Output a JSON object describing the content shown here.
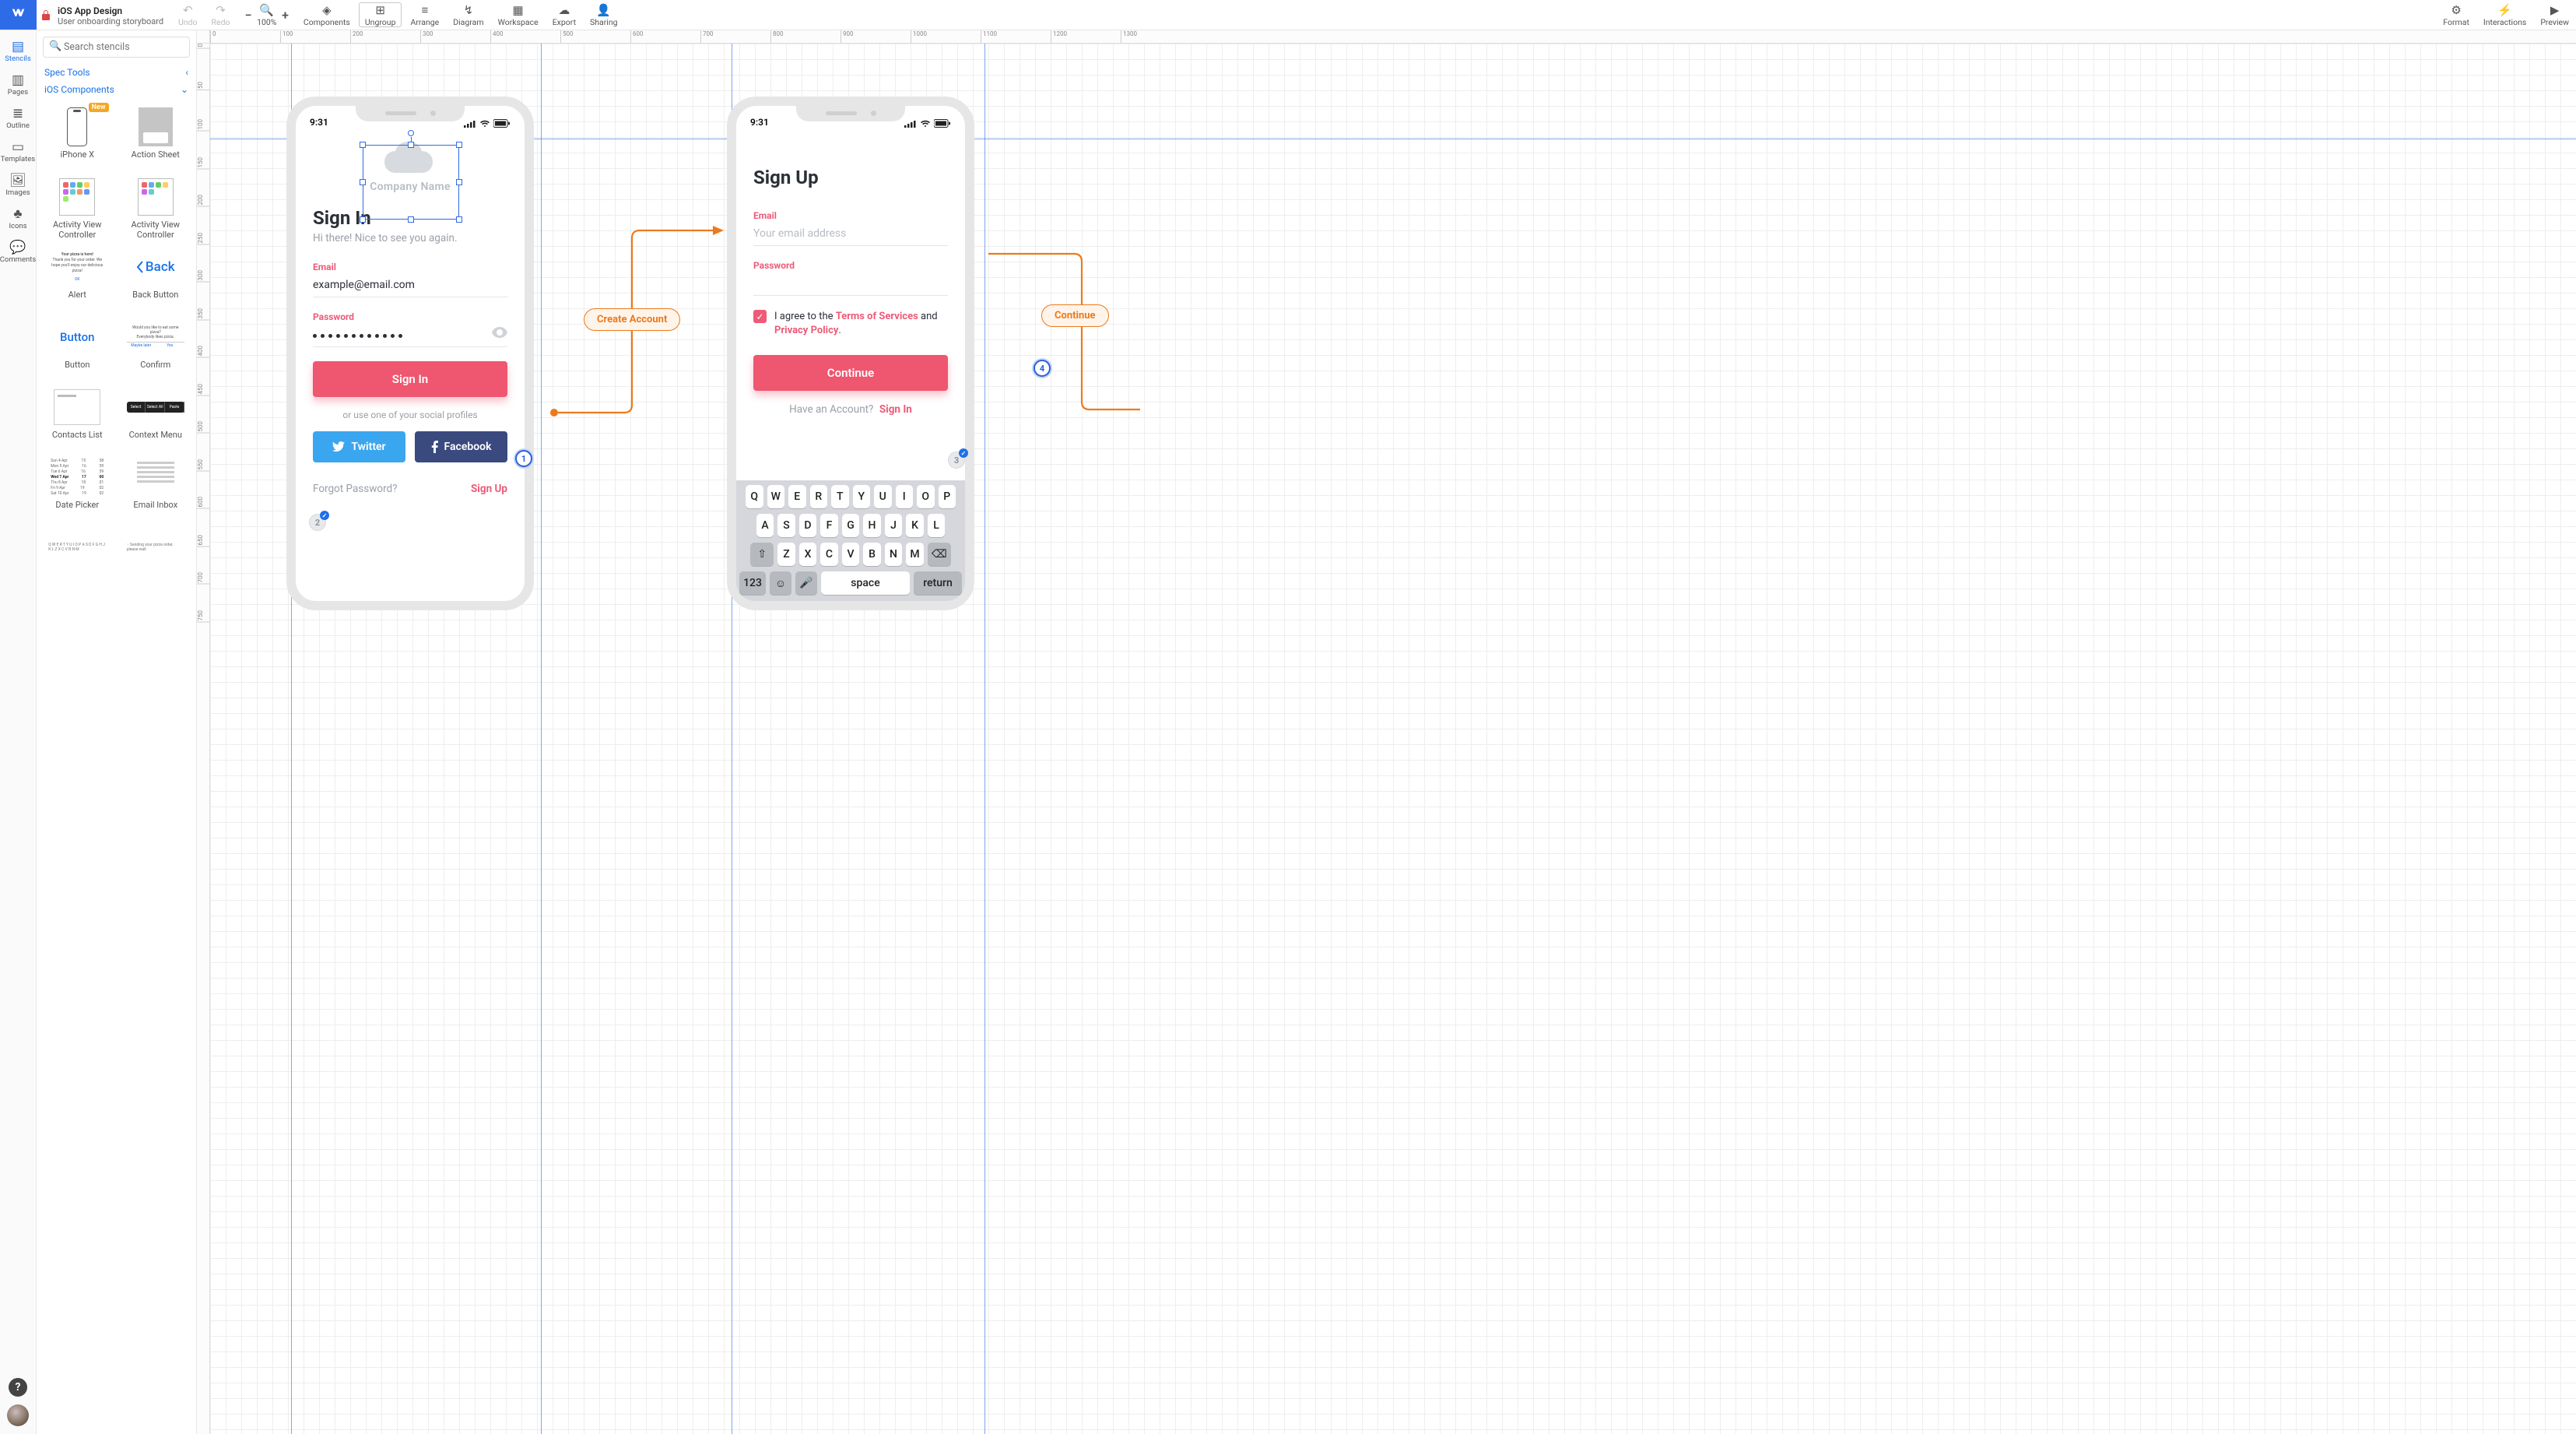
{
  "topbar": {
    "title": "iOS App Design",
    "subtitle": "User onboarding storyboard",
    "undo": "Undo",
    "redo": "Redo",
    "zoom": "100%",
    "components": "Components",
    "ungroup": "Ungroup",
    "arrange": "Arrange",
    "diagram": "Diagram",
    "workspace": "Workspace",
    "export": "Export",
    "sharing": "Sharing",
    "format": "Format",
    "interactions": "Interactions",
    "preview": "Preview"
  },
  "rail": {
    "stencils": "Stencils",
    "pages": "Pages",
    "outline": "Outline",
    "templates": "Templates",
    "images": "Images",
    "icons": "Icons",
    "comments": "Comments"
  },
  "stencils": {
    "search_placeholder": "Search stencils",
    "section_spec": "Spec Tools",
    "section_ios": "iOS Components",
    "new_badge": "New",
    "items": [
      {
        "label": "iPhone X"
      },
      {
        "label": "Action Sheet"
      },
      {
        "label": "Activity View Controller"
      },
      {
        "label": "Activity View Controller"
      },
      {
        "label": "Alert",
        "l1": "Your pizza is here!",
        "l2": "Thank you for your order. We hope you'll enjoy our delicious pizza!",
        "l3": "OK"
      },
      {
        "label": "Back Button",
        "txt": "Back"
      },
      {
        "label": "Button",
        "txt": "Button"
      },
      {
        "label": "Confirm",
        "l1": "Would you like to eat some pizza?",
        "l2": "Everybody likes pizza.",
        "b1": "Maybe later",
        "b2": "Yes"
      },
      {
        "label": "Contacts List"
      },
      {
        "label": "Context Menu",
        "b1": "Select",
        "b2": "Select All",
        "b3": "Paste"
      },
      {
        "label": "Date Picker",
        "rows": [
          [
            "Sun 4 Apr",
            "15",
            "58"
          ],
          [
            "Mon 5 Apr",
            "16",
            "59"
          ],
          [
            "Tue 6 Apr",
            "16",
            "59"
          ],
          [
            "Wed 7 Apr",
            "17",
            "00"
          ],
          [
            "Thu 8 Apr",
            "18",
            "01"
          ],
          [
            "Fri 9 Apr",
            "19",
            "02"
          ],
          [
            "Sat 10 Apr",
            "19",
            "02"
          ]
        ]
      },
      {
        "label": "Email Inbox"
      },
      {
        "label": "",
        "keys": [
          "Q",
          "W",
          "E",
          "R",
          "T",
          "Y",
          "U",
          "I",
          "O",
          "P",
          "A",
          "S",
          "D",
          "F",
          "G",
          "H",
          "J",
          "K",
          "L",
          "Z",
          "X",
          "C",
          "V",
          "B",
          "N",
          "M"
        ]
      },
      {
        "label": "",
        "txt": "Sending your pizza order, please wait"
      }
    ]
  },
  "ruler_h": [
    0,
    100,
    200,
    300,
    400,
    500,
    600,
    700,
    800,
    900,
    1000,
    1100,
    1200,
    1300
  ],
  "ruler_v": [
    0,
    50,
    100,
    150,
    200,
    250,
    300,
    350,
    400,
    450,
    500,
    550,
    600,
    650,
    700,
    750
  ],
  "phone_shared": {
    "time": "9:31"
  },
  "signin": {
    "company": "Company Name",
    "title": "Sign In",
    "subtitle": "Hi there! Nice to see you again.",
    "email_label": "Email",
    "email_value": "example@email.com",
    "password_label": "Password",
    "btn": "Sign In",
    "or": "or use one of your social profiles",
    "twitter": "Twitter",
    "facebook": "Facebook",
    "forgot": "Forgot Password?",
    "signup": "Sign Up"
  },
  "signup": {
    "title": "Sign Up",
    "email_label": "Email",
    "email_placeholder": "Your email address",
    "password_label": "Password",
    "consent_pre": "I agree to the ",
    "consent_tos": "Terms of Services",
    "consent_mid": " and ",
    "consent_pp": "Privacy Policy",
    "consent_post": ".",
    "btn": "Continue",
    "have": "Have an Account?",
    "signin": "Sign In"
  },
  "keyboard": {
    "row1": [
      "Q",
      "W",
      "E",
      "R",
      "T",
      "Y",
      "U",
      "I",
      "O",
      "P"
    ],
    "row2": [
      "A",
      "S",
      "D",
      "F",
      "G",
      "H",
      "J",
      "K",
      "L"
    ],
    "row3": [
      "Z",
      "X",
      "C",
      "V",
      "B",
      "N",
      "M"
    ],
    "num": "123",
    "space": "space",
    "return": "return"
  },
  "flows": {
    "create_account": "Create Account",
    "continue": "Continue"
  },
  "steps": {
    "s1": "1",
    "s2": "2",
    "s3": "3",
    "s4": "4"
  }
}
